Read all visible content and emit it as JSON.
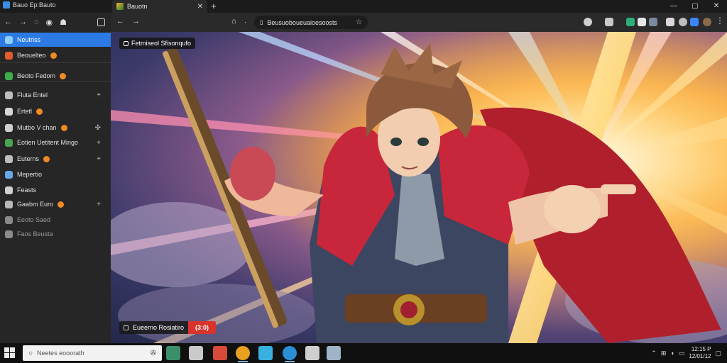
{
  "window": {
    "app_title": "Bauo Ep:Bauto",
    "tab_title": "Bauotn",
    "tab_close": "✕",
    "new_tab": "+",
    "controls": [
      "—",
      "▢",
      "✕"
    ]
  },
  "sidebar": {
    "toolbar_icons": [
      "back-arrow-icon",
      "forward-arrow-icon",
      "refresh-icon",
      "history-icon",
      "robot-icon",
      "sidebar-toggle-icon"
    ],
    "items": [
      {
        "label": "Neutriss",
        "icon_color": "#8fd0ff",
        "active": true
      },
      {
        "label": "Beouelteo",
        "icon_color": "#e25b2d",
        "badge": true
      },
      {
        "label": "Beoto Fedom",
        "icon_color": "#3cae4d",
        "badge": true
      },
      {
        "label": "Fluta Entel",
        "icon_color": "#bdbdbd",
        "action": "+"
      },
      {
        "label": "Ertetl",
        "icon_color": "#d7d7d7",
        "badge": true
      },
      {
        "label": "Mutbo V chan",
        "icon_color": "#cfcfcf",
        "badge": true,
        "action": "✣"
      },
      {
        "label": "Eotien Uetitent Mingo",
        "icon_color": "#4aa553",
        "action": "+"
      },
      {
        "label": "Euterns",
        "icon_color": "#bdbdbd",
        "badge": true,
        "action": "+"
      },
      {
        "label": "Mepertio",
        "icon_color": "#6ba6e8"
      },
      {
        "label": "Feasts",
        "icon_color": "#d0d0d0"
      },
      {
        "label": "Gaabm Euro",
        "icon_color": "#b8b8b8",
        "badge": true,
        "action": "+"
      },
      {
        "label": "Eeoto Saed",
        "icon_color": "#8a8a8a",
        "dim": true
      },
      {
        "label": "Faos Beusta",
        "icon_color": "#8a8a8a",
        "dim": true
      }
    ]
  },
  "addressbar": {
    "back": "←",
    "forward": "→",
    "home": "⌂",
    "reload": "↻",
    "url": "Beusuoboueuaioesoosts",
    "bookmark": "☆"
  },
  "video": {
    "title": "Fetmiseol Sfisonqufo",
    "caption": "Eueerno Rosiatiro",
    "caption_pill": "(3:0)"
  },
  "taskbar": {
    "search_placeholder": "Neetes eooorath",
    "apps": [
      {
        "name": "store-icon",
        "color": "#3a8f6a"
      },
      {
        "name": "game-icon",
        "color": "#c9c9c9"
      },
      {
        "name": "media-icon",
        "color": "#d84b3a"
      },
      {
        "name": "chrome-icon",
        "color": "#e8a020"
      },
      {
        "name": "photos-icon",
        "color": "#3ab0e0"
      },
      {
        "name": "browser-icon",
        "color": "#2a8fd6"
      },
      {
        "name": "app-icon",
        "color": "#cfcfcf"
      },
      {
        "name": "terminal-icon",
        "color": "#9fb4c8"
      }
    ],
    "clock_time": "12:15 P",
    "clock_date": "12/01/12"
  },
  "colors": {
    "accent": "#2c7be5",
    "pill": "#d9342b"
  }
}
